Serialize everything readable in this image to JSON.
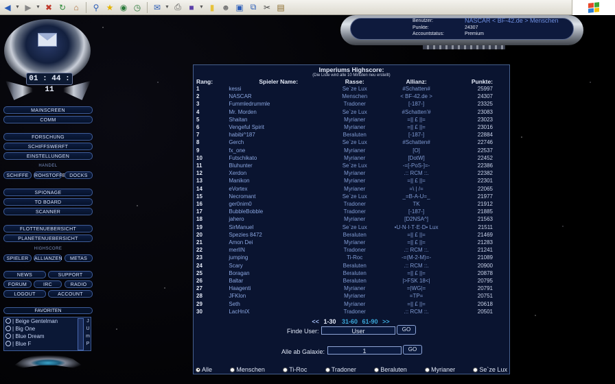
{
  "browser": {
    "toolbar_icons": [
      "back-icon",
      "forward-icon",
      "stop-icon",
      "refresh-icon",
      "home-icon",
      "search-icon",
      "favorites-icon",
      "media-icon",
      "history-icon",
      "mail-icon",
      "print-icon",
      "edit-icon",
      "notes-icon",
      "messenger-icon",
      "window-icon",
      "copy-icon",
      "cut-icon",
      "paste-icon"
    ]
  },
  "sidebar": {
    "clock": "01 : 44 : 11",
    "buttons": {
      "mainscreen": "MAINSCREEN",
      "comm": "COMM",
      "forschung": "FORSCHUNG",
      "schiffswerft": "SCHIFFSWERFT",
      "einstellungen": "EINSTELLUNGEN",
      "handel": "HANDEL",
      "schiffe": "SCHIFFE",
      "rohstoffe": "ROHSTOFFE",
      "docks": "DOCKS",
      "spionage": "SPIONAGE",
      "to_board": "TO BOARD",
      "scanner": "SCANNER",
      "flottenuebersicht": "FLOTTENUEBERSICHT",
      "planetenuebersicht": "PLANETENUEBERSICHT",
      "highscore": "HIGHSCORE",
      "spieler": "SPIELER",
      "allianzen": "ALLIANZEN",
      "metas": "METAS",
      "news": "NEWS",
      "support": "SUPPORT",
      "forum": "FORUM",
      "irc": "IRC",
      "radio": "RADIO",
      "logout": "LOGOUT",
      "account": "ACCOUNT"
    },
    "favorites_title": "FAVORITEN",
    "favorites": [
      "Beige Gentelman",
      "Big One",
      "Blue Dream",
      "Blue F"
    ],
    "favorite_letters": [
      "J",
      "U",
      "m",
      "P"
    ]
  },
  "user": {
    "benutzer_label": "Benutzer:",
    "benutzer_value": "NASCAR < BF-42.de > Menschen",
    "punkte_label": "Punkte:",
    "punkte_value": "24307",
    "status_label": "Accountstatus:",
    "status_value": "Premium"
  },
  "highscore": {
    "title": "Imperiums Highscore:",
    "subtitle": "(Die Liste wird alle 10 Minuten neu erstellt)",
    "headers": {
      "rank": "Rang:",
      "name": "Spieler Name:",
      "race": "Rasse:",
      "alliance": "Allianz:",
      "points": "Punkte:"
    },
    "rows": [
      {
        "rank": "1",
        "name": "kessi",
        "race": "Se`ze Lux",
        "alliance": "#Schatten#",
        "points": "25997"
      },
      {
        "rank": "2",
        "name": "NASCAR",
        "race": "Menschen",
        "alliance": "< BF-42.de >",
        "points": "24307"
      },
      {
        "rank": "3",
        "name": "Fummledrummle",
        "race": "Tradoner",
        "alliance": "[-187-]",
        "points": "23325"
      },
      {
        "rank": "4",
        "name": "Mr. Morden",
        "race": "Se`ze Lux",
        "alliance": "#Schatten'#",
        "points": "23083"
      },
      {
        "rank": "5",
        "name": "Shaitan",
        "race": "Myrianer",
        "alliance": "=|| £ ||=",
        "points": "23023"
      },
      {
        "rank": "6",
        "name": "Vengeful Spirit",
        "race": "Myrianer",
        "alliance": "=|| £ ||=",
        "points": "23016"
      },
      {
        "rank": "7",
        "name": "habibi^187",
        "race": "Beraluten",
        "alliance": "[-187-]",
        "points": "22884"
      },
      {
        "rank": "8",
        "name": "Gerch",
        "race": "Se`ze Lux",
        "alliance": "#Schatten#",
        "points": "22746"
      },
      {
        "rank": "9",
        "name": "fx_one",
        "race": "Myrianer",
        "alliance": "[O]",
        "points": "22537"
      },
      {
        "rank": "10",
        "name": "Futschikato",
        "race": "Myrianer",
        "alliance": "[DotW]",
        "points": "22452"
      },
      {
        "rank": "11",
        "name": "Bluhunter",
        "race": "Se`ze Lux",
        "alliance": "-=[-PoS-]=-",
        "points": "22386"
      },
      {
        "rank": "12",
        "name": "Xerdon",
        "race": "Myrianer",
        "alliance": ".:: RCM ::.",
        "points": "22382"
      },
      {
        "rank": "13",
        "name": "Manikon",
        "race": "Myrianer",
        "alliance": "=|| £ ||=",
        "points": "22301"
      },
      {
        "rank": "14",
        "name": "eVortex",
        "race": "Myrianer",
        "alliance": "=\\ | /=",
        "points": "22065"
      },
      {
        "rank": "15",
        "name": "Necromant",
        "race": "Se`ze Lux",
        "alliance": "_=B-A-U=_",
        "points": "21977"
      },
      {
        "rank": "16",
        "name": "ger0nim0",
        "race": "Tradoner",
        "alliance": "TK",
        "points": "21912"
      },
      {
        "rank": "17",
        "name": "BubbleBobble",
        "race": "Tradoner",
        "alliance": "[-187-]",
        "points": "21885"
      },
      {
        "rank": "18",
        "name": "jahero",
        "race": "Myrianer",
        "alliance": "[D2NSA^]",
        "points": "21563"
      },
      {
        "rank": "19",
        "name": "SirManuel",
        "race": "Se`ze Lux",
        "alliance": "•U·N·I·T·E·D• Lux",
        "points": "21511"
      },
      {
        "rank": "20",
        "name": "Spezies 8472",
        "race": "Beraluten",
        "alliance": "=|| £ ||=",
        "points": "21469"
      },
      {
        "rank": "21",
        "name": "Amon Dei",
        "race": "Myrianer",
        "alliance": "=|| £ ||=",
        "points": "21283"
      },
      {
        "rank": "22",
        "name": "merlIN",
        "race": "Tradoner",
        "alliance": ".:: RCM ::.",
        "points": "21241"
      },
      {
        "rank": "23",
        "name": "jumping",
        "race": "Ti-Roc",
        "alliance": "-=(M-2-M)=-",
        "points": "21089"
      },
      {
        "rank": "24",
        "name": "Scary",
        "race": "Beraluten",
        "alliance": ".:: RCM ::.",
        "points": "20900"
      },
      {
        "rank": "25",
        "name": "Boragan",
        "race": "Beraluten",
        "alliance": "=|| £ ||=",
        "points": "20878"
      },
      {
        "rank": "26",
        "name": "Baltar",
        "race": "Beraluten",
        "alliance": "|>FSK 18<|",
        "points": "20795"
      },
      {
        "rank": "27",
        "name": "Haagenti",
        "race": "Myrianer",
        "alliance": "=|WG|=",
        "points": "20791"
      },
      {
        "rank": "28",
        "name": "JFKlon",
        "race": "Myrianer",
        "alliance": "=TP=",
        "points": "20751"
      },
      {
        "rank": "29",
        "name": "Seth",
        "race": "Myrianer",
        "alliance": "=|| £ ||=",
        "points": "20618"
      },
      {
        "rank": "30",
        "name": "LacHniX",
        "race": "Tradoner",
        "alliance": ".:: RCM ::.",
        "points": "20501"
      }
    ],
    "pager": {
      "prev": "<<",
      "current": "1-30",
      "pages": [
        "31-60",
        "61-90"
      ],
      "next": ">>"
    },
    "find_user_label": "Finde User:",
    "find_user_value": "User",
    "galaxy_label": "Alle ab Galaxie:",
    "galaxy_value": "1",
    "go_label": "GO",
    "filters": [
      {
        "label": "Alle",
        "selected": true
      },
      {
        "label": "Menschen",
        "selected": false
      },
      {
        "label": "Ti-Roc",
        "selected": false
      },
      {
        "label": "Tradoner",
        "selected": false
      },
      {
        "label": "Beraluten",
        "selected": false
      },
      {
        "label": "Myrianer",
        "selected": false
      },
      {
        "label": "Se`ze Lux",
        "selected": false
      }
    ]
  }
}
